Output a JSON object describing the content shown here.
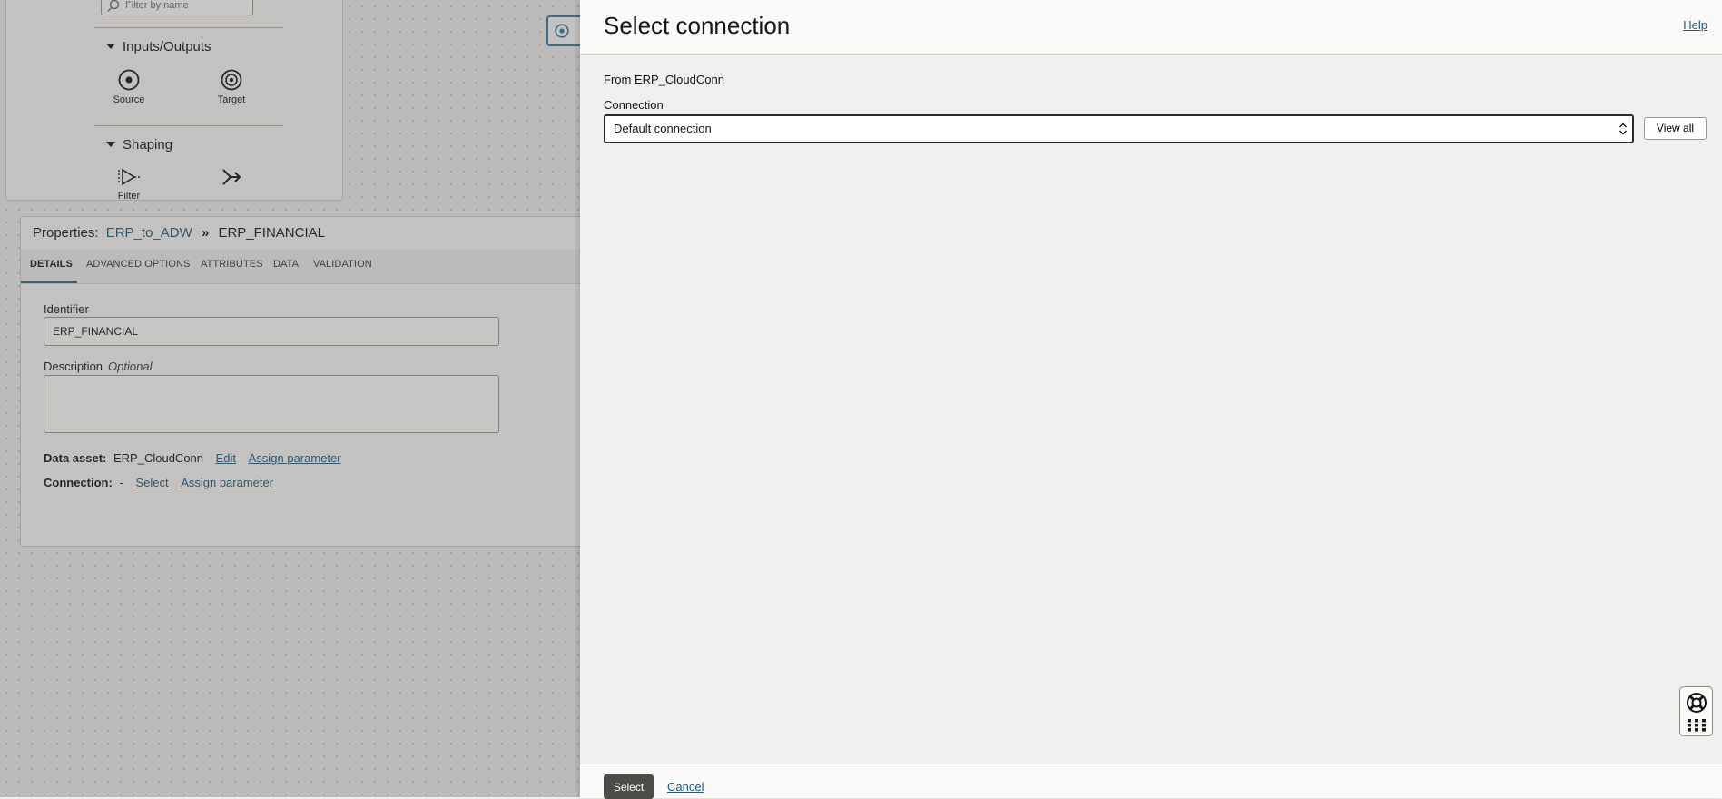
{
  "palette": {
    "filter_placeholder": "Filter by name",
    "sections": [
      {
        "label": "Inputs/Outputs",
        "items": [
          {
            "label": "Source",
            "icon": "source-icon"
          },
          {
            "label": "Target",
            "icon": "target-icon"
          }
        ]
      },
      {
        "label": "Shaping",
        "items": [
          {
            "label": "Filter",
            "icon": "filter-icon"
          },
          {
            "label": "",
            "icon": "join-icon"
          }
        ]
      }
    ]
  },
  "properties": {
    "title_prefix": "Properties:",
    "flow_link": "ERP_to_ADW",
    "separator": "»",
    "operator_name": "ERP_FINANCIAL",
    "tabs": [
      "DETAILS",
      "ADVANCED OPTIONS",
      "ATTRIBUTES",
      "DATA",
      "VALIDATION"
    ],
    "active_tab": "DETAILS",
    "identifier_label": "Identifier",
    "identifier_value": "ERP_FINANCIAL",
    "description_label": "Description",
    "description_optional": "Optional",
    "description_value": "",
    "data_asset_label": "Data asset:",
    "data_asset_value": "ERP_CloudConn",
    "edit_link": "Edit",
    "assign_parameter_link": "Assign parameter",
    "connection_label": "Connection:",
    "connection_value": "-",
    "select_link": "Select"
  },
  "drawer": {
    "title": "Select connection",
    "help_link": "Help",
    "from_text": "From ERP_CloudConn",
    "connection_label": "Connection",
    "connection_value": "Default connection",
    "view_all_label": "View all",
    "select_button": "Select",
    "cancel_link": "Cancel"
  },
  "colors": {
    "accent_link": "#1f5a7a",
    "primary_button": "#4e4c49",
    "node_border": "#2e7aa8"
  }
}
